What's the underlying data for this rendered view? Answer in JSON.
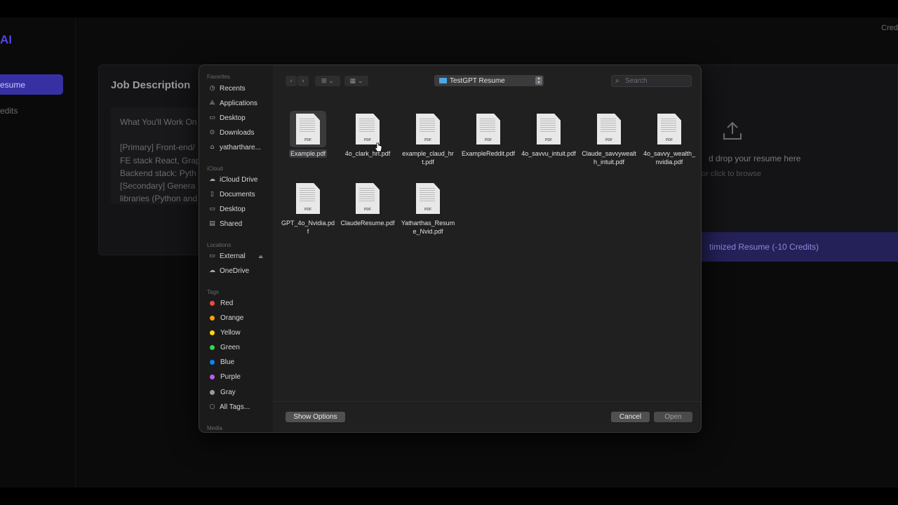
{
  "app": {
    "brand": "AI",
    "nav_active": "esume",
    "nav_credits": "edits",
    "credits_top": "Cred"
  },
  "job_card": {
    "title": "Job Description",
    "text": "What You'll Work On\n\n[Primary] Front-end/\nFE stack React, Grap\nBackend stack: Pyth\n[Secondary] Genera\nlibraries (Python and"
  },
  "upload_card": {
    "drop_text": "d drop your resume here",
    "browse_text": "or click to browse",
    "button_label": "timized Resume (-10 Credits)"
  },
  "dialog": {
    "sidebar": {
      "favorites_label": "Favorites",
      "favorites": [
        {
          "label": "Recents",
          "icon": "clock-icon"
        },
        {
          "label": "Applications",
          "icon": "applications-icon"
        },
        {
          "label": "Desktop",
          "icon": "desktop-icon"
        },
        {
          "label": "Downloads",
          "icon": "downloads-icon"
        },
        {
          "label": "yathartharе...",
          "icon": "home-icon"
        }
      ],
      "icloud_label": "iCloud",
      "icloud": [
        {
          "label": "iCloud Drive",
          "icon": "cloud-icon"
        },
        {
          "label": "Documents",
          "icon": "documents-icon"
        },
        {
          "label": "Desktop",
          "icon": "desktop-icon"
        },
        {
          "label": "Shared",
          "icon": "shared-folder-icon"
        }
      ],
      "locations_label": "Locations",
      "locations": [
        {
          "label": "External",
          "icon": "drive-icon"
        },
        {
          "label": "OneDrive",
          "icon": "cloud-icon"
        }
      ],
      "tags_label": "Tags",
      "tags": [
        {
          "label": "Red",
          "color": "#ff453a"
        },
        {
          "label": "Orange",
          "color": "#ff9f0a"
        },
        {
          "label": "Yellow",
          "color": "#ffd60a"
        },
        {
          "label": "Green",
          "color": "#32d74b"
        },
        {
          "label": "Blue",
          "color": "#0a84ff"
        },
        {
          "label": "Purple",
          "color": "#bf5af2"
        },
        {
          "label": "Gray",
          "color": "#98989d"
        }
      ],
      "all_tags": "All Tags...",
      "media_label": "Media"
    },
    "toolbar": {
      "folder": "TestGPT Resume",
      "search_placeholder": "Search"
    },
    "files": [
      {
        "name": "Example.pdf",
        "selected": true
      },
      {
        "name": "4o_clark_hrt.pdf"
      },
      {
        "name": "example_claud_hrt.pdf"
      },
      {
        "name": "ExampleReddit.pdf"
      },
      {
        "name": "4o_savvu_intuit.pdf"
      },
      {
        "name": "Claude_savvywealth_intuit.pdf"
      },
      {
        "name": "4o_savvy_wealth_nvidia.pdf"
      },
      {
        "name": "GPT_4o_Nvidia.pdf"
      },
      {
        "name": "ClaudeResume.pdf"
      },
      {
        "name": "Yatharthas_Resume_Nvid.pdf"
      }
    ],
    "file_type_tag": "PDF",
    "buttons": {
      "show_options": "Show Options",
      "cancel": "Cancel",
      "open": "Open"
    }
  }
}
